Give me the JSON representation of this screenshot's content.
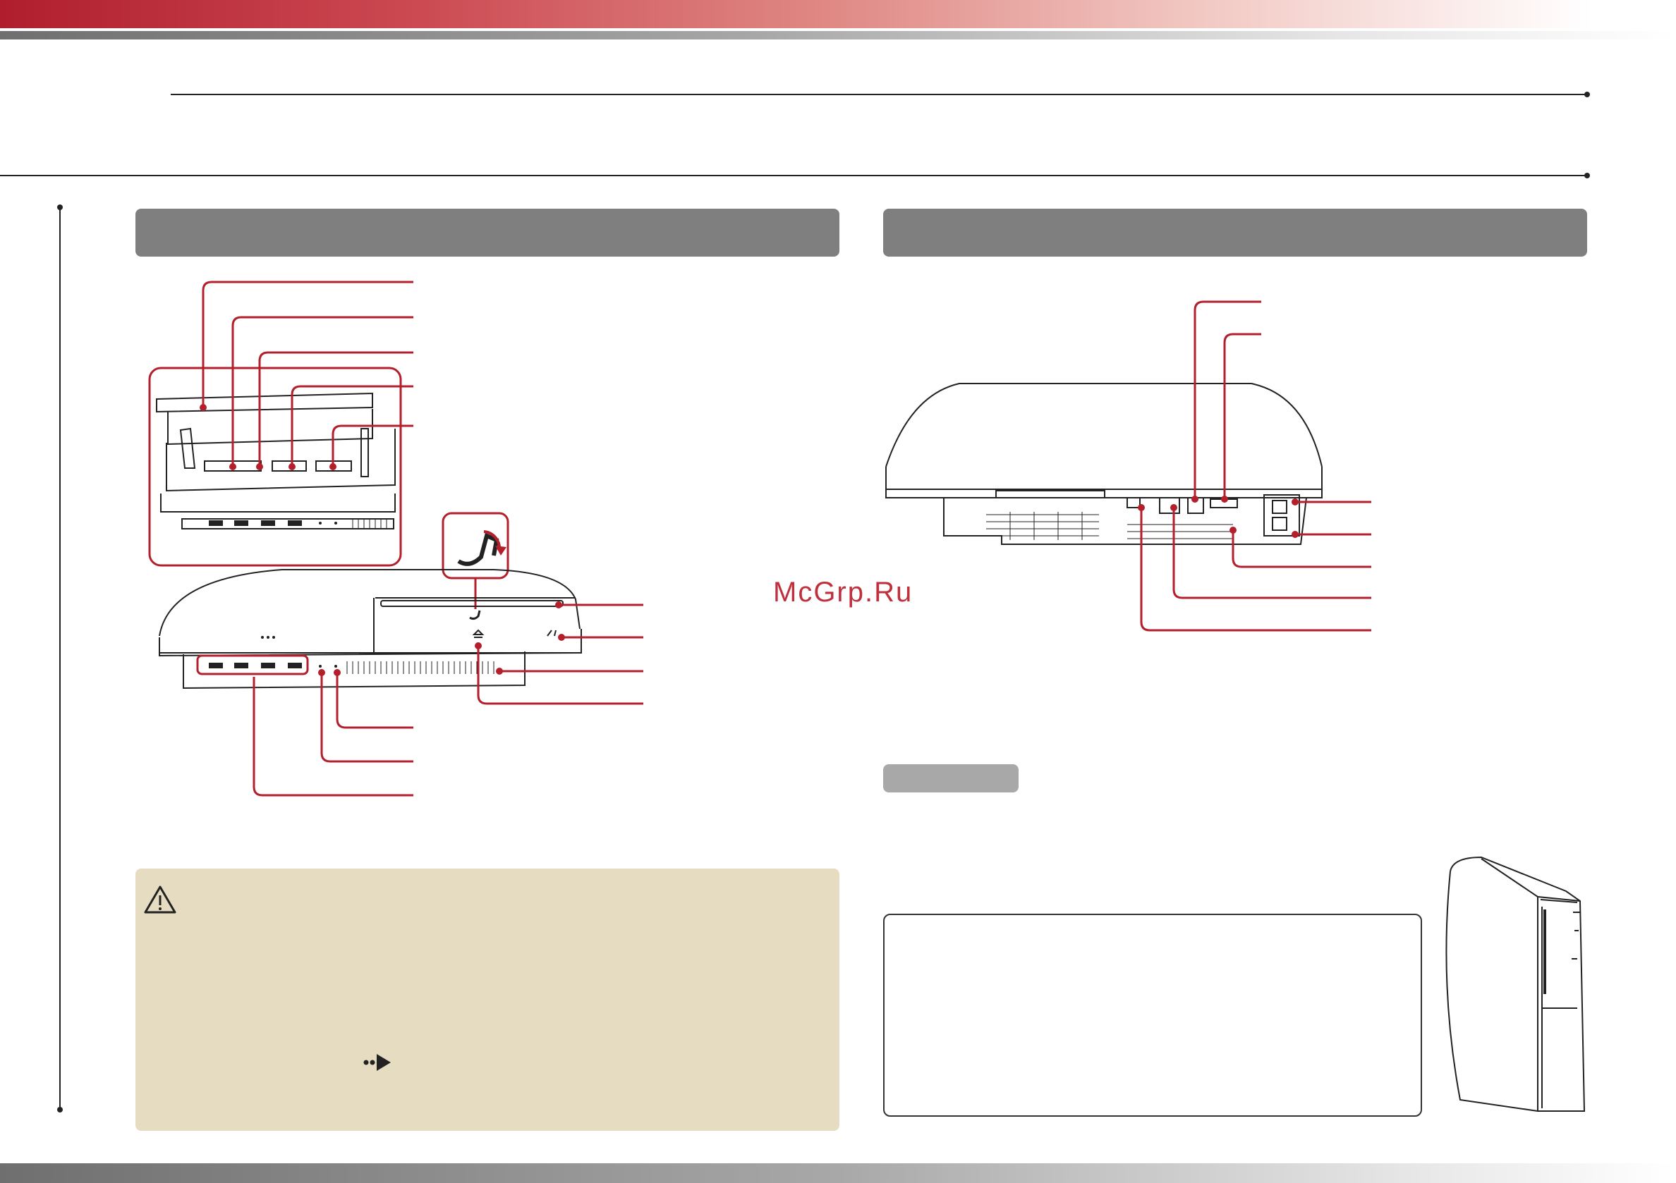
{
  "watermark": {
    "text": "McGrp.Ru"
  },
  "icons": {
    "caution": "warning-triangle-icon",
    "arrow": "double-dot-arrow-icon",
    "logo_rotate": "ps-logo-rotate-icon"
  },
  "colors": {
    "accent": "#b01e2e",
    "section_bar": "#7f7f7f",
    "caution_bg": "#e6dcc1",
    "callout": "#b3202c"
  }
}
